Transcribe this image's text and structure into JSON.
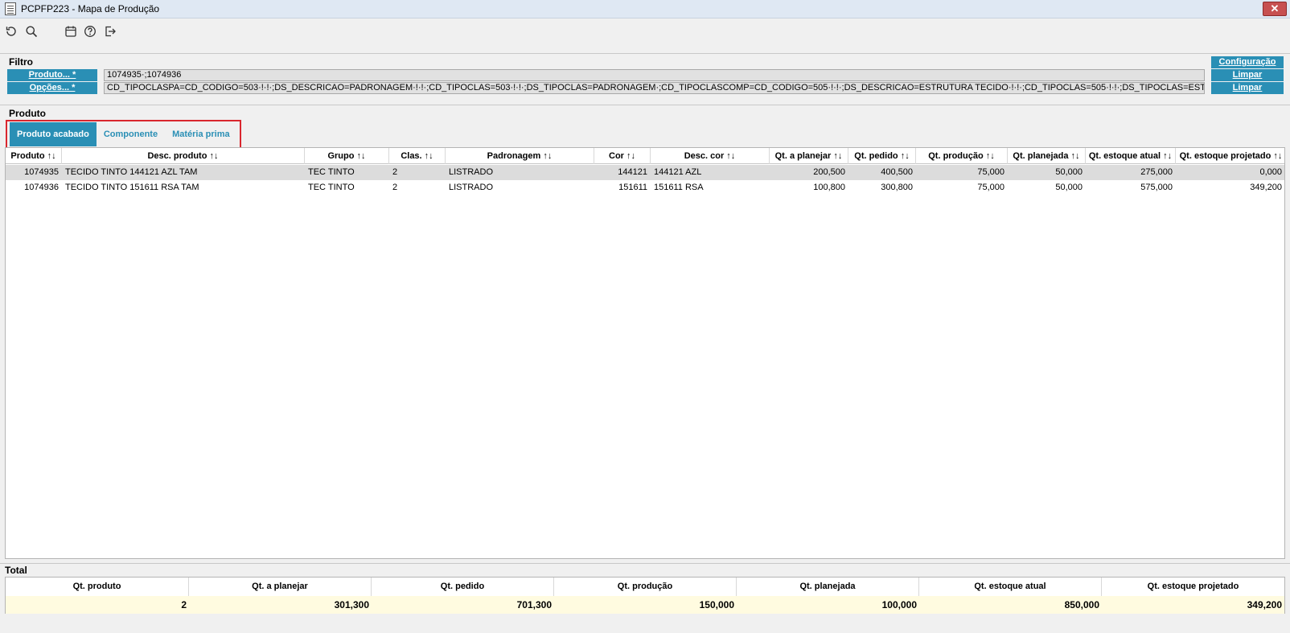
{
  "window": {
    "title": "PCPFP223 - Mapa de Produção",
    "close_label": "✕"
  },
  "toolbar": {
    "icons": [
      "refresh-icon",
      "search-icon",
      "calendar-icon",
      "help-icon",
      "exit-icon"
    ]
  },
  "filter": {
    "section_label": "Filtro",
    "produto_label": "Produto... *",
    "produto_value": "1074935·;1074936",
    "opcoes_label": "Opções... *",
    "opcoes_value": "CD_TIPOCLASPA=CD_CODIGO=503·!·!·;DS_DESCRICAO=PADRONAGEM·!·!·;CD_TIPOCLAS=503·!·!·;DS_TIPOCLAS=PADRONAGEM·;CD_TIPOCLASCOMP=CD_CODIGO=505·!·!·;DS_DESCRICAO=ESTRUTURA TECIDO·!·!·;CD_TIPOCLAS=505·!·!·;DS_TIPOCLAS=ESTRUTURA TECIDO·;CD_",
    "configuracao_label": "Configuração",
    "limpar_produto_label": "Limpar",
    "limpar_opcoes_label": "Limpar"
  },
  "produto_section": {
    "label": "Produto",
    "tabs": [
      {
        "label": "Produto acabado",
        "active": true
      },
      {
        "label": "Componente",
        "active": false
      },
      {
        "label": "Matéria prima",
        "active": false
      }
    ]
  },
  "grid": {
    "columns": [
      "Produto ↑↓",
      "Desc. produto ↑↓",
      "Grupo ↑↓",
      "Clas. ↑↓",
      "Padronagem ↑↓",
      "Cor ↑↓",
      "Desc. cor ↑↓",
      "Qt. a planejar ↑↓",
      "Qt. pedido ↑↓",
      "Qt. produção ↑↓",
      "Qt. planejada ↑↓",
      "Qt. estoque atual ↑↓",
      "Qt. estoque projetado ↑↓"
    ],
    "rows": [
      [
        "1074935",
        "TECIDO TINTO 144121 AZL TAM",
        "TEC TINTO",
        "2",
        "LISTRADO",
        "144121",
        "144121 AZL",
        "200,500",
        "400,500",
        "75,000",
        "50,000",
        "275,000",
        "0,000"
      ],
      [
        "1074936",
        "TECIDO TINTO 151611 RSA TAM",
        "TEC TINTO",
        "2",
        "LISTRADO",
        "151611",
        "151611 RSA",
        "100,800",
        "300,800",
        "75,000",
        "50,000",
        "575,000",
        "349,200"
      ]
    ]
  },
  "total": {
    "label": "Total",
    "headers": [
      "Qt. produto",
      "Qt. a planejar",
      "Qt. pedido",
      "Qt. produção",
      "Qt. planejada",
      "Qt. estoque atual",
      "Qt. estoque projetado"
    ],
    "values": [
      "2",
      "301,300",
      "701,300",
      "150,000",
      "100,000",
      "850,000",
      "349,200"
    ]
  },
  "colors": {
    "accent": "#2a8fb5",
    "highlight_border": "#d9262e",
    "selected_row": "#dcdcdc",
    "total_row_bg": "#fffbe0"
  }
}
